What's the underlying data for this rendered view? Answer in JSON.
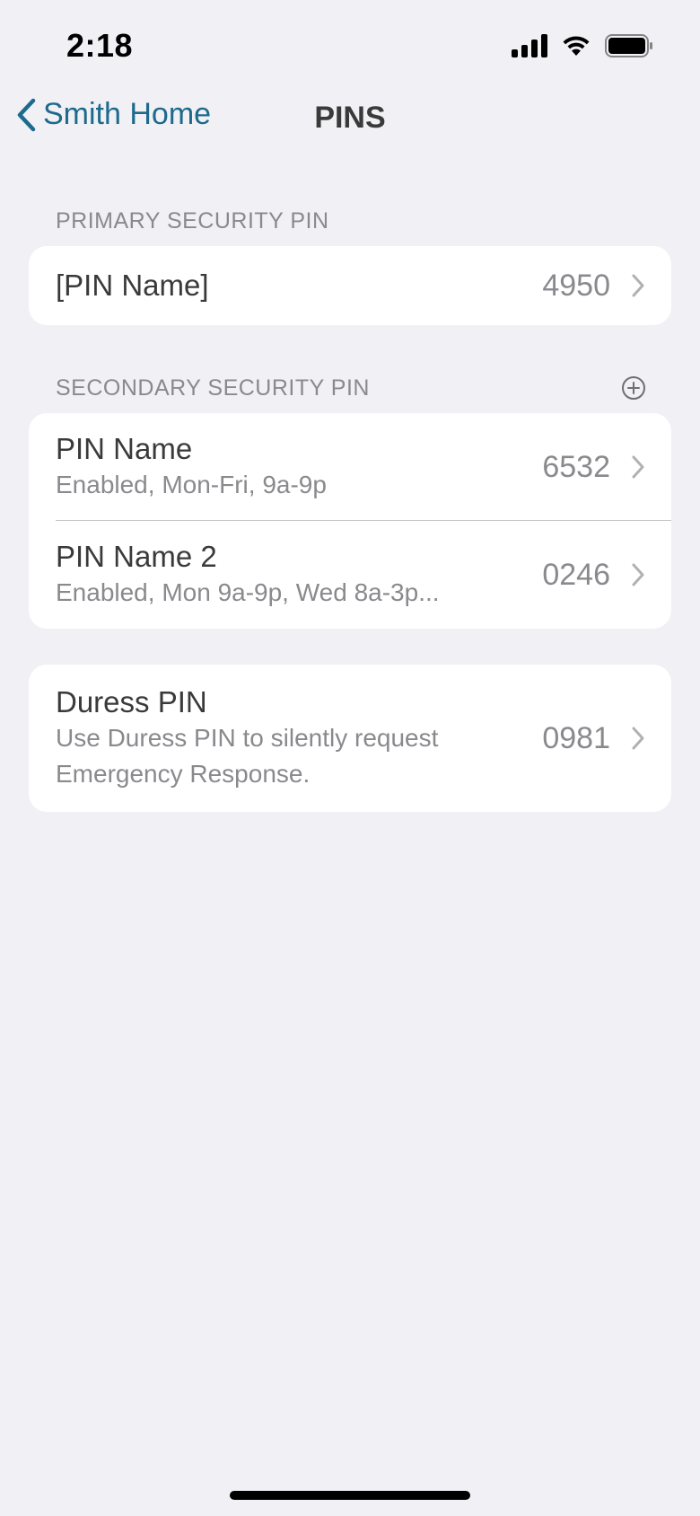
{
  "status_bar": {
    "time": "2:18",
    "icons": [
      "cellular-signal-icon",
      "wifi-icon",
      "battery-icon"
    ]
  },
  "nav": {
    "back_label": "Smith Home",
    "title": "PINS"
  },
  "primary": {
    "header": "PRIMARY SECURITY PIN",
    "rows": [
      {
        "title": "[PIN Name]",
        "value": "4950"
      }
    ]
  },
  "secondary": {
    "header": "SECONDARY SECURITY PIN",
    "rows": [
      {
        "title": "PIN Name",
        "subtitle": "Enabled, Mon-Fri, 9a-9p",
        "value": "6532"
      },
      {
        "title": "PIN Name 2",
        "subtitle": "Enabled, Mon 9a-9p, Wed 8a-3p...",
        "value": "0246"
      }
    ]
  },
  "duress": {
    "title": "Duress PIN",
    "subtitle": "Use Duress PIN to silently request Emergency Response.",
    "value": "0981"
  },
  "colors": {
    "accent": "#1d6a8c",
    "background": "#f0f0f5",
    "card": "#ffffff",
    "secondary_text": "#8a8a8e"
  }
}
